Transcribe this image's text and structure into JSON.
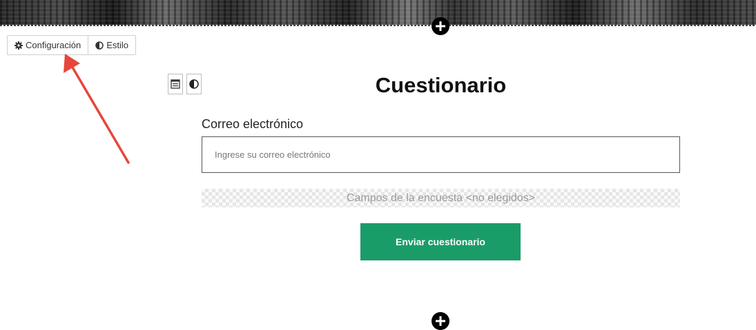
{
  "toolbar": {
    "config_label": "Configuración",
    "config_icon": "gear-icon",
    "style_label": "Estilo",
    "style_icon": "contrast-icon"
  },
  "block_tools": {
    "form_icon": "form-icon",
    "style_icon": "contrast-icon"
  },
  "form": {
    "title": "Cuestionario",
    "email_label": "Correo electrónico",
    "email_value": "",
    "email_placeholder": "Ingrese su correo electrónico",
    "survey_fields_text": "Campos de la encuesta <no elegidos>",
    "submit_label": "Enviar cuestionario"
  },
  "colors": {
    "submit_bg": "#1a9c69",
    "annotation_arrow": "#e8453c"
  }
}
